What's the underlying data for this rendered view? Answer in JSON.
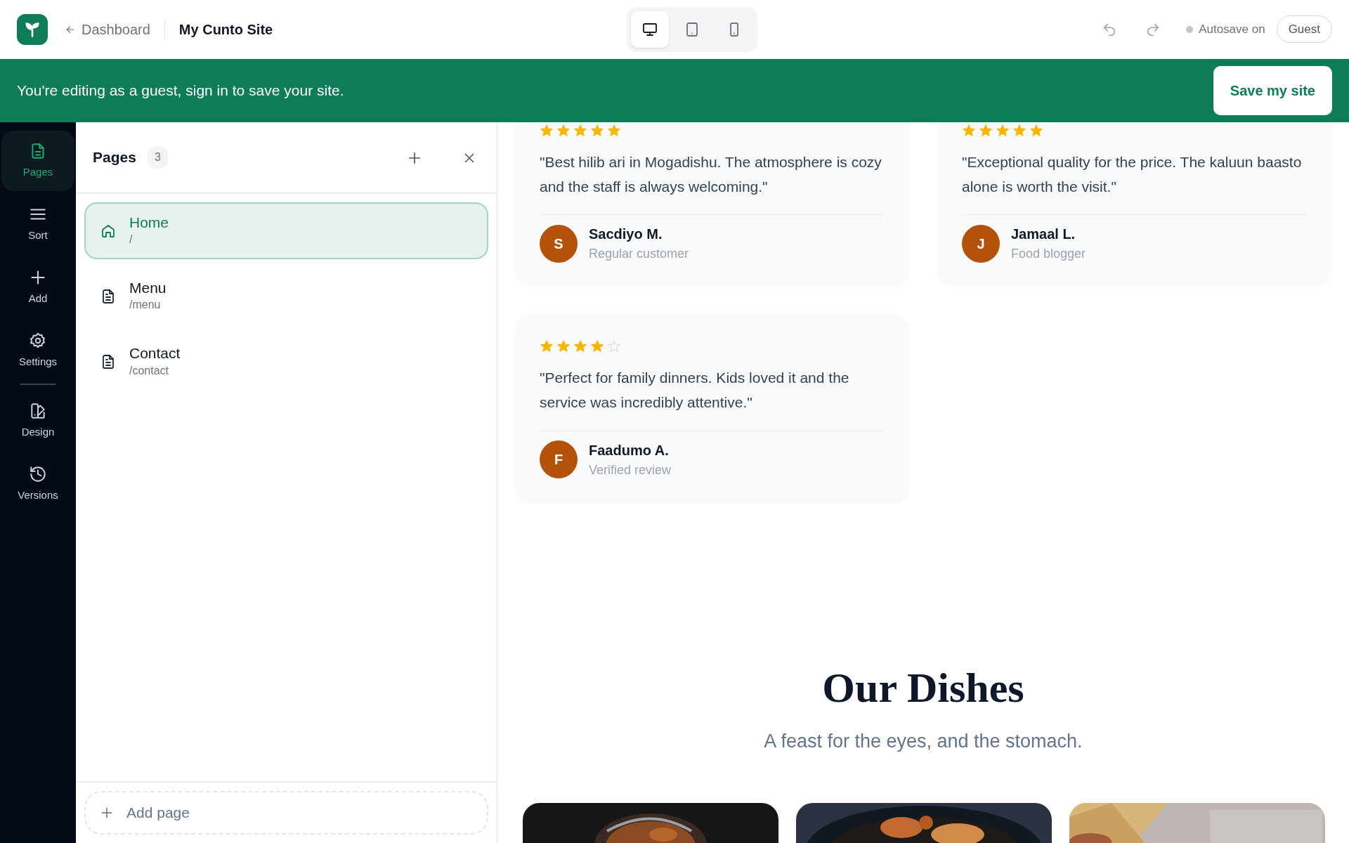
{
  "header": {
    "back_label": "Dashboard",
    "site_name": "My Cunto Site",
    "devices": [
      {
        "kind": "desktop",
        "selected": true
      },
      {
        "kind": "tablet",
        "selected": false
      },
      {
        "kind": "mobile",
        "selected": false
      }
    ],
    "autosave": "Autosave on",
    "user": "Guest"
  },
  "banner": {
    "message": "You're editing as a guest, sign in to save your site.",
    "button": "Save my site"
  },
  "rail": {
    "groups": [
      [
        {
          "kind": "pages",
          "label": "Pages",
          "selected": true
        },
        {
          "kind": "sort",
          "label": "Sort",
          "selected": false
        },
        {
          "kind": "add",
          "label": "Add",
          "selected": false
        },
        {
          "kind": "settings",
          "label": "Settings",
          "selected": false
        }
      ],
      [
        {
          "kind": "design",
          "label": "Design",
          "selected": false
        },
        {
          "kind": "versions",
          "label": "Versions",
          "selected": false
        }
      ]
    ]
  },
  "pages_panel": {
    "title": "Pages",
    "count": "3",
    "pages": [
      {
        "kind": "home",
        "name": "Home",
        "path": "/",
        "selected": true
      },
      {
        "kind": "page",
        "name": "Menu",
        "path": "/menu",
        "selected": false
      },
      {
        "kind": "page",
        "name": "Contact",
        "path": "/contact",
        "selected": false
      }
    ],
    "add_label": "Add page"
  },
  "reviews": [
    {
      "stars": 5,
      "quote": "\"Best hilib ari in Mogadishu. The atmosphere is cozy and the staff is always welcoming.\"",
      "initial": "S",
      "author": "Sacdiyo M.",
      "role": "Regular customer"
    },
    {
      "stars": 5,
      "quote": "\"Exceptional quality for the price. The kaluun baasto alone is worth the visit.\"",
      "initial": "J",
      "author": "Jamaal L.",
      "role": "Food blogger"
    },
    {
      "stars": 4,
      "quote": "\"Perfect for family dinners. Kids loved it and the service was incredibly attentive.\"",
      "initial": "F",
      "author": "Faadumo A.",
      "role": "Verified review"
    }
  ],
  "dishes": {
    "title": "Our Dishes",
    "subtitle": "A feast for the eyes, and the stomach."
  }
}
